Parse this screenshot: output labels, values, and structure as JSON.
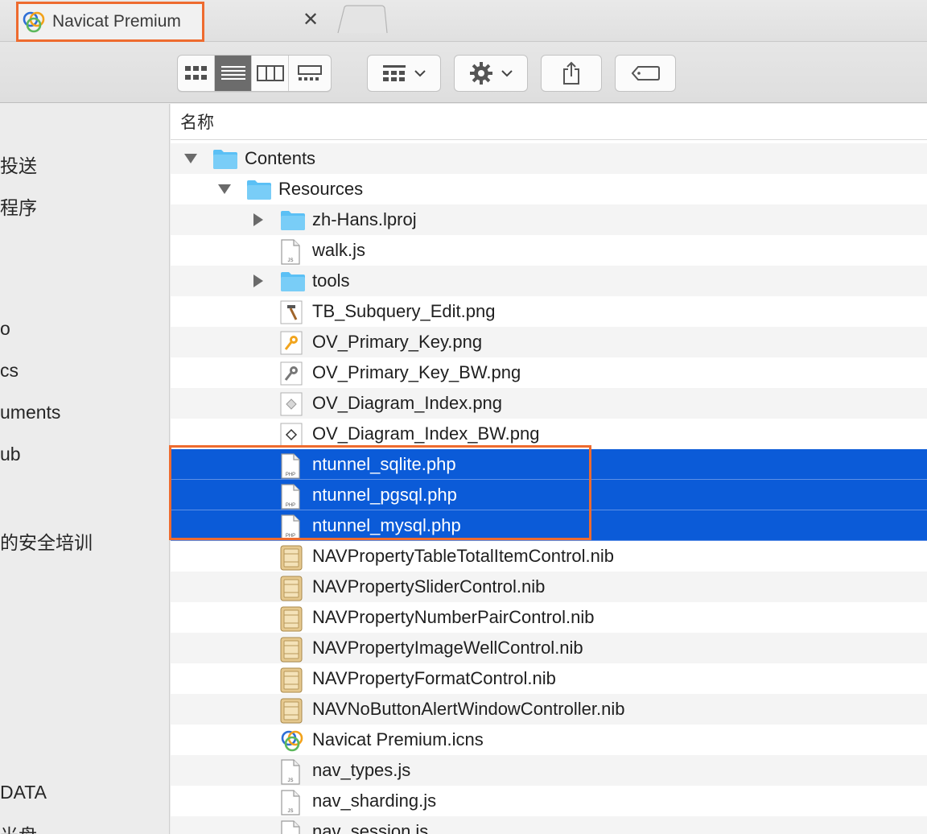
{
  "tab": {
    "title": "Navicat Premium",
    "close": "✕"
  },
  "toolbar": {
    "view_modes": [
      "icon-view",
      "list-view",
      "column-view",
      "gallery-view"
    ],
    "active_view": "list-view",
    "group_icon": "group-by-icon",
    "action_icon": "gear-icon",
    "share_icon": "share-icon",
    "tag_icon": "tag-icon"
  },
  "sidebar": {
    "items": [
      "投送",
      "程序",
      "o",
      "cs",
      "uments",
      "ub",
      "的安全培训",
      "DATA",
      "光盘"
    ]
  },
  "list": {
    "column_name": "名称",
    "rows": [
      {
        "name": "Contents",
        "icon": "folder-icon",
        "disclosure": "expanded",
        "level": 0
      },
      {
        "name": "Resources",
        "icon": "folder-icon",
        "disclosure": "expanded",
        "level": 1
      },
      {
        "name": "zh-Hans.lproj",
        "icon": "folder-icon",
        "disclosure": "collapsed",
        "level": 2
      },
      {
        "name": "walk.js",
        "icon": "js-file-icon",
        "disclosure": "none",
        "level": 2
      },
      {
        "name": "tools",
        "icon": "folder-icon",
        "disclosure": "collapsed",
        "level": 2
      },
      {
        "name": "TB_Subquery_Edit.png",
        "icon": "hammer-png-icon",
        "disclosure": "none",
        "level": 2
      },
      {
        "name": "OV_Primary_Key.png",
        "icon": "key-png-icon",
        "disclosure": "none",
        "level": 2
      },
      {
        "name": "OV_Primary_Key_BW.png",
        "icon": "key-bw-png-icon",
        "disclosure": "none",
        "level": 2
      },
      {
        "name": "OV_Diagram_Index.png",
        "icon": "diamond-png-icon",
        "disclosure": "none",
        "level": 2
      },
      {
        "name": "OV_Diagram_Index_BW.png",
        "icon": "diamond-bw-png-icon",
        "disclosure": "none",
        "level": 2
      },
      {
        "name": "ntunnel_sqlite.php",
        "icon": "php-file-icon",
        "disclosure": "none",
        "level": 2,
        "selected": true
      },
      {
        "name": "ntunnel_pgsql.php",
        "icon": "php-file-icon",
        "disclosure": "none",
        "level": 2,
        "selected": true
      },
      {
        "name": "ntunnel_mysql.php",
        "icon": "php-file-icon",
        "disclosure": "none",
        "level": 2,
        "selected": true
      },
      {
        "name": "NAVPropertyTableTotalItemControl.nib",
        "icon": "nib-file-icon",
        "disclosure": "none",
        "level": 2
      },
      {
        "name": "NAVPropertySliderControl.nib",
        "icon": "nib-file-icon",
        "disclosure": "none",
        "level": 2
      },
      {
        "name": "NAVPropertyNumberPairControl.nib",
        "icon": "nib-file-icon",
        "disclosure": "none",
        "level": 2
      },
      {
        "name": "NAVPropertyImageWellControl.nib",
        "icon": "nib-file-icon",
        "disclosure": "none",
        "level": 2
      },
      {
        "name": "NAVPropertyFormatControl.nib",
        "icon": "nib-file-icon",
        "disclosure": "none",
        "level": 2
      },
      {
        "name": "NAVNoButtonAlertWindowController.nib",
        "icon": "nib-file-icon",
        "disclosure": "none",
        "level": 2
      },
      {
        "name": "Navicat Premium.icns",
        "icon": "navicat-icns-icon",
        "disclosure": "none",
        "level": 2
      },
      {
        "name": "nav_types.js",
        "icon": "js-file-icon",
        "disclosure": "none",
        "level": 2
      },
      {
        "name": "nav_sharding.js",
        "icon": "js-file-icon",
        "disclosure": "none",
        "level": 2
      },
      {
        "name": "nav_session.js",
        "icon": "js-file-icon",
        "disclosure": "none",
        "level": 2
      }
    ]
  },
  "colors": {
    "selection": "#0b5bd8",
    "highlight_frame": "#ee6b2f",
    "folder": "#5bc0f5"
  }
}
